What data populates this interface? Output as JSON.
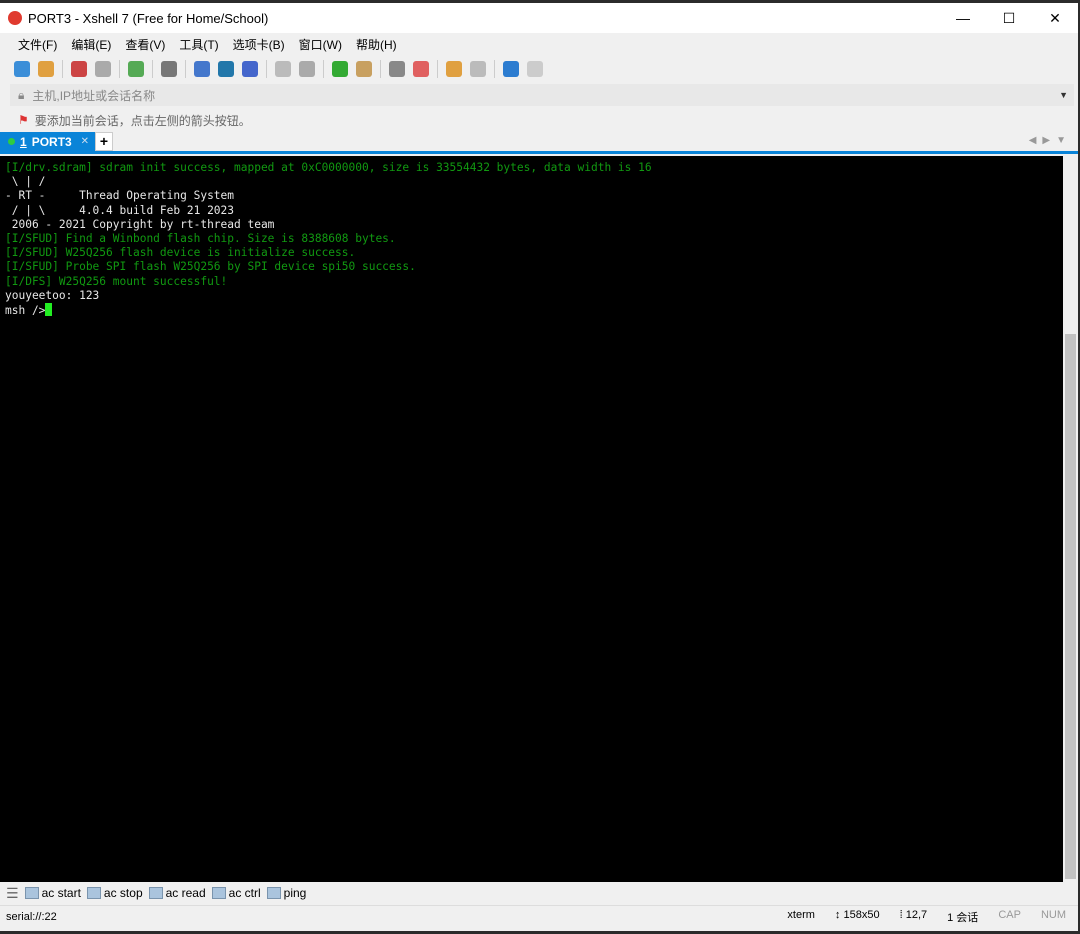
{
  "window": {
    "title": "PORT3 - Xshell 7 (Free for Home/School)",
    "controls": [
      "—",
      "☐",
      "✕"
    ]
  },
  "menu": [
    "文件(F)",
    "编辑(E)",
    "查看(V)",
    "工具(T)",
    "选项卡(B)",
    "窗口(W)",
    "帮助(H)"
  ],
  "toolbar": {
    "icons": [
      "new-session",
      "open-folder",
      "disconnect",
      "reconnect",
      "session-properties",
      "find",
      "transfer",
      "globe",
      "font",
      "xftp",
      "screenshot",
      "fullscreen",
      "lock",
      "keyboard",
      "highlight",
      "new-folder",
      "layout",
      "help",
      "chat"
    ],
    "colors": [
      "#3b8ed8",
      "#e0a040",
      "#cc4444",
      "#aaaaaa",
      "#55aa55",
      "#777777",
      "#4477cc",
      "#2277aa",
      "#4466cc",
      "#bbbbbb",
      "#aaaaaa",
      "#33aa33",
      "#c8a060",
      "#888888",
      "#e06060",
      "#e0a040",
      "#bbbbbb",
      "#2c7cd0",
      "#cccccc"
    ]
  },
  "address": {
    "placeholder": "主机,IP地址或会话名称"
  },
  "hint": "要添加当前会话，点击左侧的箭头按钮。",
  "tabs": [
    {
      "index": "1",
      "label": "PORT3",
      "status_color": "#2ecc40"
    }
  ],
  "terminal": {
    "lines": [
      {
        "text": "[I/drv.sdram] sdram init success, mapped at 0xC0000000, size is 33554432 bytes, data width is 16",
        "color": "g"
      },
      {
        "text": "",
        "color": "w"
      },
      {
        "text": " \\ | /",
        "color": "w"
      },
      {
        "text": "- RT -     Thread Operating System",
        "color": "w"
      },
      {
        "text": " / | \\     4.0.4 build Feb 21 2023",
        "color": "w"
      },
      {
        "text": " 2006 - 2021 Copyright by rt-thread team",
        "color": "w"
      },
      {
        "text": "[I/SFUD] Find a Winbond flash chip. Size is 8388608 bytes.",
        "color": "g"
      },
      {
        "text": "[I/SFUD] W25Q256 flash device is initialize success.",
        "color": "g"
      },
      {
        "text": "[I/SFUD] Probe SPI flash W25Q256 by SPI device spi50 success.",
        "color": "g"
      },
      {
        "text": "[I/DFS] W25Q256 mount successful!",
        "color": "g"
      },
      {
        "text": "youyeetoo: 123",
        "color": "w"
      }
    ],
    "prompt": "msh />"
  },
  "quick_commands": [
    "ac start",
    "ac stop",
    "ac read",
    "ac ctrl",
    "ping"
  ],
  "status": {
    "connection": "serial://:22",
    "term": "xterm",
    "size": "158x50",
    "cursor": "12,7",
    "sessions": "1 会话",
    "caps": "CAP",
    "num": "NUM"
  }
}
